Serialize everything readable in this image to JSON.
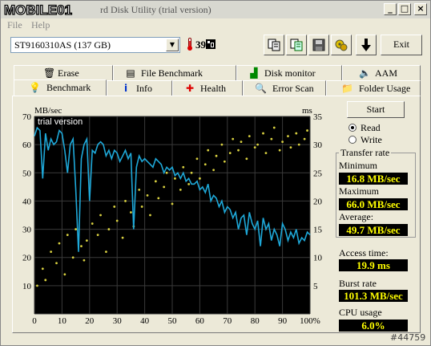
{
  "window": {
    "logo_text": "MOBILE01",
    "title": "rd Disk Utility (trial version)",
    "buttons": {
      "minimize": "_",
      "maximize": "□",
      "close": "×"
    }
  },
  "menu": {
    "file": "File",
    "help": "Help"
  },
  "toolbar": {
    "drive": "ST9160310AS (137 GB)",
    "temperature": "39",
    "exit_label": "Exit",
    "icons": [
      "copy-icon",
      "copy-all-icon",
      "save-icon",
      "options-icon",
      "download-arrow-icon"
    ]
  },
  "tabs_top": [
    {
      "label": "Erase",
      "icon": "trash-icon"
    },
    {
      "label": "File Benchmark",
      "icon": "file-benchmark-icon"
    },
    {
      "label": "Disk monitor",
      "icon": "disk-monitor-icon"
    },
    {
      "label": "AAM",
      "icon": "speaker-icon"
    }
  ],
  "tabs_bottom": [
    {
      "label": "Benchmark",
      "icon": "benchmark-icon"
    },
    {
      "label": "Info",
      "icon": "info-icon"
    },
    {
      "label": "Health",
      "icon": "health-cross-icon"
    },
    {
      "label": "Error Scan",
      "icon": "error-scan-icon"
    },
    {
      "label": "Folder Usage",
      "icon": "folder-icon"
    }
  ],
  "controls": {
    "start": "Start",
    "read": "Read",
    "write": "Write",
    "selected_mode": "read"
  },
  "stats": {
    "transfer_rate_title": "Transfer rate",
    "minimum_label": "Minimum",
    "minimum": "16.8 MB/sec",
    "maximum_label": "Maximum",
    "maximum": "66.0 MB/sec",
    "average_label": "Average:",
    "average": "49.7 MB/sec",
    "access_label": "Access time:",
    "access": "19.9 ms",
    "burst_label": "Burst rate",
    "burst": "101.3 MB/sec",
    "cpu_label": "CPU usage",
    "cpu": "6.0%"
  },
  "watermark": "#44759",
  "chart_data": {
    "type": "line",
    "watermark": "trial version",
    "ylabel_left": "MB/sec",
    "ylabel_right": "ms",
    "ylim_left": [
      0,
      70
    ],
    "ylim_right": [
      0,
      35
    ],
    "yticks_left": [
      "10",
      "20",
      "30",
      "40",
      "50",
      "60",
      "70"
    ],
    "yticks_right": [
      "5",
      "10",
      "15",
      "20",
      "25",
      "30",
      "35"
    ],
    "xticks": [
      "0",
      "10",
      "20",
      "30",
      "40",
      "50",
      "60",
      "70",
      "80",
      "90",
      "100%"
    ],
    "xlim": [
      0,
      100
    ],
    "grid": true,
    "colors": {
      "background": "#000000",
      "grid": "#3a3a3a",
      "transfer": "#1ea8d8",
      "access": "#d8d040"
    },
    "series": [
      {
        "x": [
          0,
          1,
          2,
          3,
          4,
          5,
          6,
          7,
          8,
          9,
          10,
          11,
          12,
          13,
          14,
          15,
          16,
          17,
          18,
          19,
          20,
          21,
          22,
          23,
          24,
          25,
          26,
          27,
          28,
          29,
          30,
          31,
          32,
          33,
          34,
          35,
          36,
          37,
          38,
          39,
          40,
          41,
          42,
          43,
          44,
          45,
          46,
          47,
          48,
          49,
          50,
          51,
          52,
          53,
          54,
          55,
          56,
          57,
          58,
          59,
          60,
          61,
          62,
          63,
          64,
          65,
          66,
          67,
          68,
          69,
          70,
          71,
          72,
          73,
          74,
          75,
          76,
          77,
          78,
          79,
          80,
          81,
          82,
          83,
          84,
          85,
          86,
          87,
          88,
          89,
          90,
          91,
          92,
          93,
          94,
          95,
          96,
          97,
          98,
          99,
          100
        ],
        "values": [
          63,
          66,
          65,
          48,
          64,
          58,
          62,
          60,
          61,
          65,
          64,
          58,
          50,
          60,
          62,
          44,
          22,
          55,
          60,
          62,
          40,
          58,
          57,
          60,
          61,
          60,
          56,
          58,
          55,
          58,
          57,
          54,
          56,
          58,
          55,
          57,
          30,
          52,
          56,
          54,
          55,
          54,
          53,
          52,
          55,
          54,
          53,
          50,
          52,
          51,
          52,
          49,
          50,
          48,
          50,
          47,
          48,
          46,
          46,
          47,
          44,
          45,
          43,
          46,
          40,
          42,
          41,
          38,
          40,
          36,
          38,
          37,
          34,
          36,
          30,
          34,
          35,
          28,
          36,
          32,
          30,
          33,
          24,
          34,
          30,
          32,
          26,
          30,
          28,
          24,
          32,
          30,
          26,
          29,
          27,
          30,
          25,
          27,
          26,
          29,
          28
        ]
      }
    ],
    "scatter": {
      "x": [
        1,
        3,
        4,
        6,
        8,
        9,
        11,
        12,
        14,
        15,
        17,
        18,
        19,
        21,
        23,
        24,
        26,
        27,
        29,
        30,
        32,
        33,
        35,
        36,
        38,
        39,
        41,
        42,
        44,
        45,
        47,
        48,
        50,
        51,
        53,
        54,
        56,
        57,
        59,
        60,
        62,
        63,
        65,
        66,
        68,
        69,
        71,
        72,
        74,
        75,
        77,
        78,
        80,
        81,
        83,
        84,
        86,
        87,
        89,
        90,
        92,
        93,
        95,
        96,
        98,
        99
      ],
      "values": [
        10,
        16,
        12,
        22,
        18,
        25,
        14,
        28,
        20,
        30,
        24,
        19,
        26,
        32,
        28,
        35,
        22,
        30,
        38,
        33,
        27,
        40,
        36,
        31,
        44,
        38,
        42,
        35,
        47,
        41,
        45,
        50,
        39,
        48,
        44,
        52,
        46,
        50,
        55,
        48,
        53,
        58,
        51,
        56,
        60,
        54,
        57,
        62,
        58,
        61,
        55,
        63,
        59,
        60,
        64,
        57,
        62,
        66,
        58,
        61,
        63,
        59,
        64,
        60,
        62,
        65
      ]
    }
  }
}
